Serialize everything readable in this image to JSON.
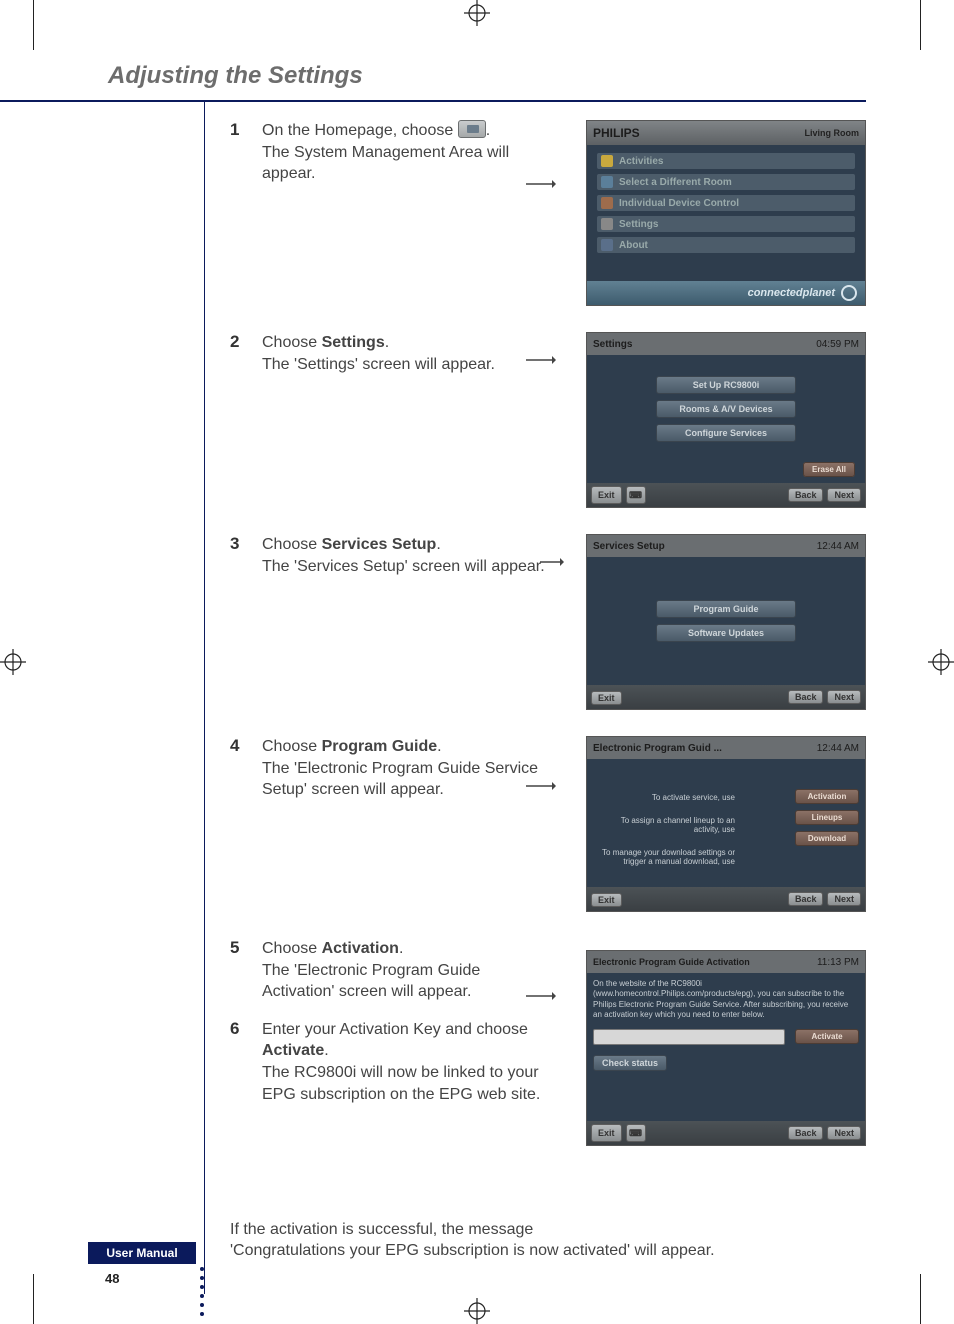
{
  "section_title": "Adjusting the Settings",
  "user_manual_label": "User Manual",
  "page_number": "48",
  "steps": [
    {
      "num": "1",
      "line1_a": "On the Homepage, choose ",
      "line1_b": ".",
      "line2": "The System Management Area will appear.",
      "screenshot": {
        "logo": "PHILIPS",
        "room": "Living Room",
        "items": [
          "Activities",
          "Select a Different Room",
          "Individual Device Control",
          "Settings",
          "About"
        ],
        "footer": "connectedplanet"
      }
    },
    {
      "num": "2",
      "line1": "Choose <b>Settings</b>.",
      "line2": "The 'Settings' screen will appear.",
      "screenshot": {
        "title": "Settings",
        "time": "04:59 PM",
        "pills": [
          "Set Up RC9800i",
          "Rooms & A/V Devices",
          "Configure Services"
        ],
        "erase": "Erase All",
        "buttons_left": [
          "Exit"
        ],
        "buttons_right": [
          "Back",
          "Next"
        ]
      }
    },
    {
      "num": "3",
      "line1": "Choose <b>Services Setup</b>.",
      "line2": "The 'Services Setup' screen will appear.",
      "screenshot": {
        "title": "Services Setup",
        "time": "12:44 AM",
        "pills": [
          "Program Guide",
          "Software Updates"
        ],
        "buttons_left": [
          "Exit"
        ],
        "buttons_right": [
          "Back",
          "Next"
        ]
      }
    },
    {
      "num": "4",
      "line1": "Choose <b>Program Guide</b>.",
      "line2": "The 'Electronic Program Guide Service Setup' screen will appear.",
      "screenshot": {
        "title": "Electronic Program Guid ...",
        "time": "12:44 AM",
        "left_labels": [
          "To activate service, use",
          "To assign a channel lineup to an activity, use",
          "To manage your download settings or trigger a manual download, use"
        ],
        "right_buttons": [
          "Activation",
          "Lineups",
          "Download"
        ],
        "buttons_left": [
          "Exit"
        ],
        "buttons_right": [
          "Back",
          "Next"
        ]
      }
    },
    {
      "num": "5",
      "line1": "Choose <b>Activation</b>.",
      "line2": "The 'Electronic Program Guide Activation' screen will appear."
    },
    {
      "num": "6",
      "line1": "Enter your Activation Key and choose <b>Activate</b>.",
      "line2": "The RC9800i will now be linked to your EPG subscription on the EPG web site.",
      "screenshot": {
        "title": "Electronic Program Guide Activation",
        "time": "11:13 PM",
        "body_text": "On the website of the RC9800i (www.homecontrol.Philips.com/products/epg), you can subscribe to the Philips Electronic Program Guide Service. After subscribing, you receive an activation key which you need to enter below.",
        "activate_btn": "Activate",
        "check_status": "Check status",
        "buttons_left": [
          "Exit"
        ],
        "buttons_right": [
          "Back",
          "Next"
        ]
      }
    }
  ],
  "tail": "If the activation is successful, the message\n'Congratulations your EPG subscription is now activated' will appear."
}
